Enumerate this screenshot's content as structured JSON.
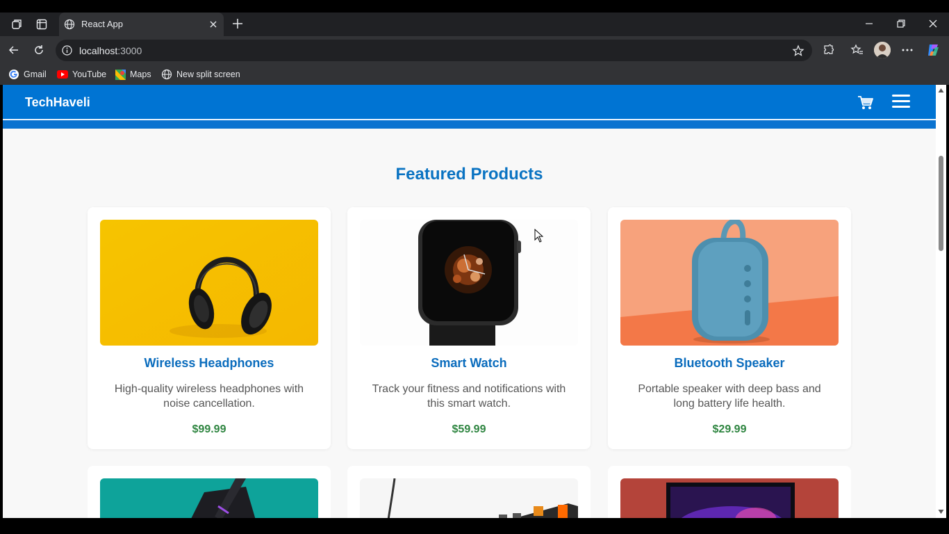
{
  "browser": {
    "tab_title": "React App",
    "url_host": "localhost",
    "url_port": ":3000",
    "bookmarks": [
      {
        "label": "Gmail",
        "icon": "google-icon",
        "color": "#ea4335"
      },
      {
        "label": "YouTube",
        "icon": "youtube-icon",
        "color": "#ff0000"
      },
      {
        "label": "Maps",
        "icon": "maps-icon",
        "color": "#34a853"
      },
      {
        "label": "New split screen",
        "icon": "globe-icon",
        "color": "#e8eaed"
      }
    ]
  },
  "navbar": {
    "brand": "TechHaveli",
    "color": "#0074d3"
  },
  "main": {
    "title": "Featured Products",
    "products": [
      {
        "name": "Wireless Headphones",
        "description": "High-quality wireless headphones with noise cancellation.",
        "price": "$99.99"
      },
      {
        "name": "Smart Watch",
        "description": "Track your fitness and notifications with this smart watch.",
        "price": "$59.99"
      },
      {
        "name": "Bluetooth Speaker",
        "description": "Portable speaker with deep bass and long battery life health.",
        "price": "$29.99"
      }
    ]
  }
}
